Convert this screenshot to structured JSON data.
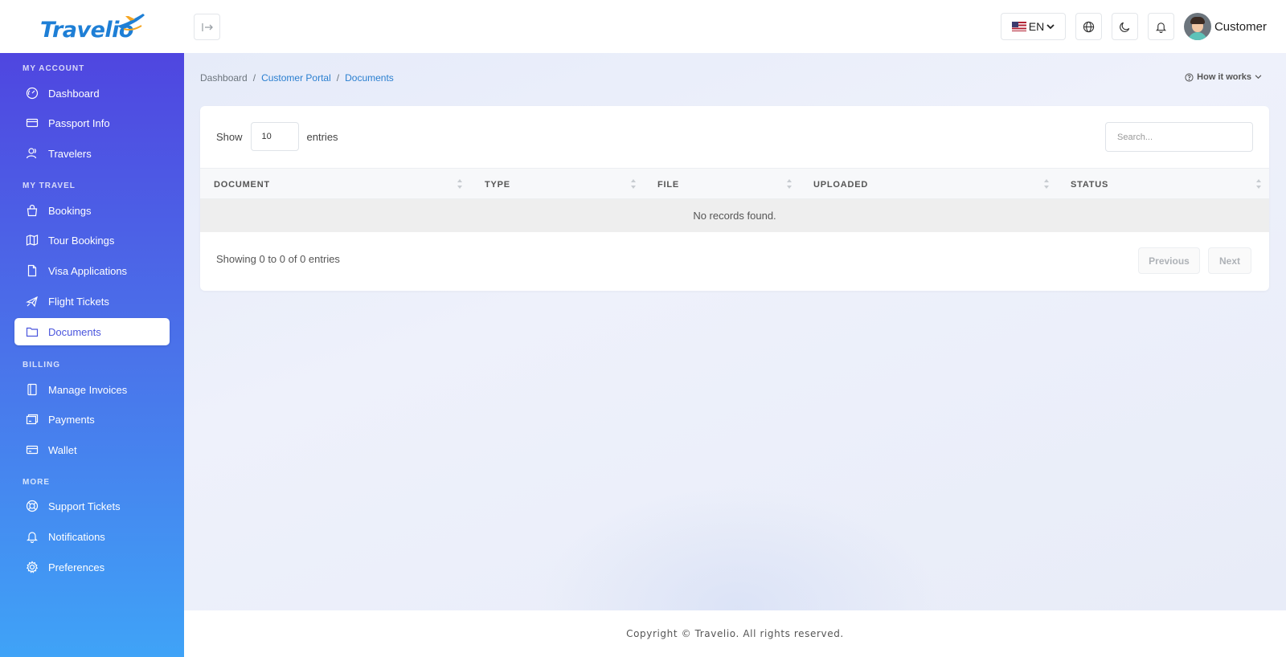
{
  "brand": {
    "name": "Travelio"
  },
  "topbar": {
    "language": "EN",
    "user_name": "Customer"
  },
  "sidebar": {
    "sections": [
      {
        "title": "MY ACCOUNT",
        "items": [
          {
            "label": "Dashboard",
            "icon": "dashboard-icon"
          },
          {
            "label": "Passport Info",
            "icon": "card-icon"
          },
          {
            "label": "Travelers",
            "icon": "travelers-icon"
          }
        ]
      },
      {
        "title": "MY TRAVEL",
        "items": [
          {
            "label": "Bookings",
            "icon": "bag-icon"
          },
          {
            "label": "Tour Bookings",
            "icon": "map-icon"
          },
          {
            "label": "Visa Applications",
            "icon": "file-icon"
          },
          {
            "label": "Flight Tickets",
            "icon": "plane-icon"
          },
          {
            "label": "Documents",
            "icon": "folder-icon",
            "active": true
          }
        ]
      },
      {
        "title": "BILLING",
        "items": [
          {
            "label": "Manage Invoices",
            "icon": "invoice-icon"
          },
          {
            "label": "Payments",
            "icon": "payments-icon"
          },
          {
            "label": "Wallet",
            "icon": "wallet-icon"
          }
        ]
      },
      {
        "title": "MORE",
        "items": [
          {
            "label": "Support Tickets",
            "icon": "lifebuoy-icon"
          },
          {
            "label": "Notifications",
            "icon": "bell-icon"
          },
          {
            "label": "Preferences",
            "icon": "gear-icon"
          }
        ]
      }
    ]
  },
  "breadcrumb": {
    "items": [
      "Dashboard",
      "Customer Portal",
      "Documents"
    ],
    "separator": "/"
  },
  "help": {
    "label": "How it works"
  },
  "table": {
    "show_label": "Show",
    "entries_value": "10",
    "entries_label": "entries",
    "search_placeholder": "Search...",
    "columns": [
      "DOCUMENT",
      "TYPE",
      "FILE",
      "UPLOADED",
      "STATUS"
    ],
    "empty_message": "No records found.",
    "info": "Showing 0 to 0 of 0 entries",
    "prev_label": "Previous",
    "next_label": "Next"
  },
  "footer": {
    "text": "Copyright © Travelio. All rights reserved."
  },
  "colors": {
    "sidebar_top": "#4f46e0",
    "sidebar_bottom": "#3fa3f7",
    "link": "#2a7fd0",
    "brand": "#1e7fd6"
  }
}
